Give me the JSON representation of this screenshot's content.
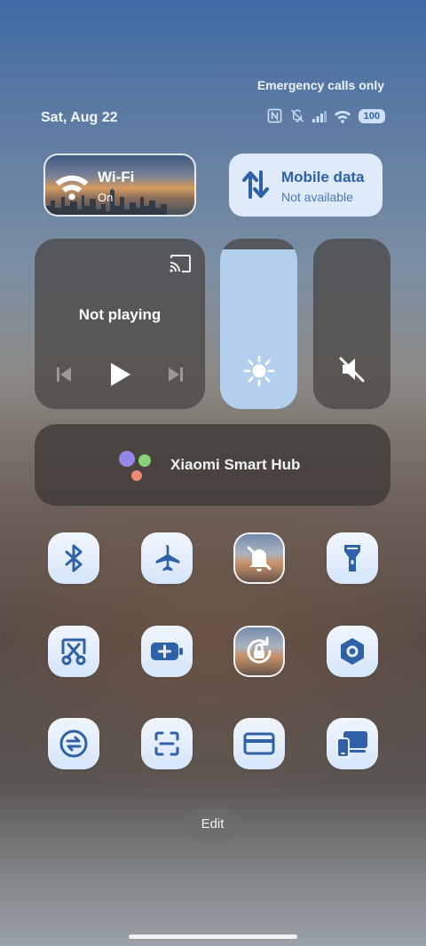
{
  "status": {
    "emergency": "Emergency calls only",
    "date": "Sat, Aug 22",
    "battery": "100",
    "icons": [
      "nfc-icon",
      "vibrate-off-icon",
      "signal-icon",
      "wifi-signal-icon",
      "battery-icon"
    ]
  },
  "tiles": {
    "wifi": {
      "title": "Wi-Fi",
      "state": "On"
    },
    "mobile": {
      "title": "Mobile data",
      "state": "Not available"
    }
  },
  "media": {
    "status": "Not playing",
    "icons": [
      "cast-icon",
      "previous-icon",
      "play-icon",
      "next-icon"
    ]
  },
  "brightness": {
    "level": 0.94,
    "icon": "sun-icon"
  },
  "volume": {
    "level": 0.0,
    "icon": "mute-icon"
  },
  "hub": {
    "label": "Xiaomi Smart Hub"
  },
  "toggles": [
    {
      "name": "bluetooth",
      "icon": "bluetooth-icon",
      "active": true
    },
    {
      "name": "airplane-mode",
      "icon": "airplane-icon",
      "active": true
    },
    {
      "name": "do-not-disturb",
      "icon": "bell-off-icon",
      "active": false
    },
    {
      "name": "flashlight",
      "icon": "flashlight-icon",
      "active": true
    },
    {
      "name": "screenshot",
      "icon": "scissors-icon",
      "active": true
    },
    {
      "name": "battery-saver",
      "icon": "battery-plus-icon",
      "active": true
    },
    {
      "name": "rotation-lock",
      "icon": "rotation-lock-icon",
      "active": false
    },
    {
      "name": "location",
      "icon": "location-icon",
      "active": true
    },
    {
      "name": "sync",
      "icon": "sync-icon",
      "active": true
    },
    {
      "name": "scanner",
      "icon": "scan-icon",
      "active": true
    },
    {
      "name": "card",
      "icon": "card-icon",
      "active": true
    },
    {
      "name": "cast-screen",
      "icon": "devices-icon",
      "active": true
    }
  ],
  "edit_label": "Edit"
}
